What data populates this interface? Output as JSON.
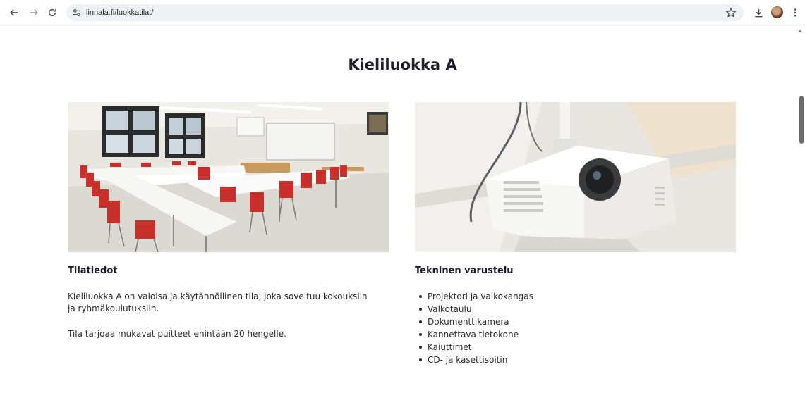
{
  "browser": {
    "url": "linnala.fi/luokkatilat/"
  },
  "page": {
    "title": "Kieliluokka A"
  },
  "images": {
    "left": "classroom-photo",
    "right": "projector-photo"
  },
  "info": {
    "heading": "Tilatiedot",
    "paragraph1": "Kieliluokka A on valoisa ja käytännöllinen tila, joka soveltuu kokouksiin ja ryhmäkoulutuksiin.",
    "paragraph2": "Tila tarjoaa mukavat puitteet enintään 20 hengelle."
  },
  "equipment": {
    "heading": "Tekninen varustelu",
    "items": [
      "Projektori ja valkokangas",
      "Valkotaulu",
      "Dokumenttikamera",
      "Kannettava tietokone",
      "Kaiuttimet",
      "CD- ja kasettisoitin"
    ]
  },
  "colors": {
    "omnibox": "#eef1f6",
    "heading": "#1e1e2a",
    "chair_red": "#c8302c"
  },
  "icons": [
    "back-icon",
    "forward-icon",
    "reload-icon",
    "site-info-icon",
    "star-icon",
    "download-icon",
    "more-icon"
  ]
}
